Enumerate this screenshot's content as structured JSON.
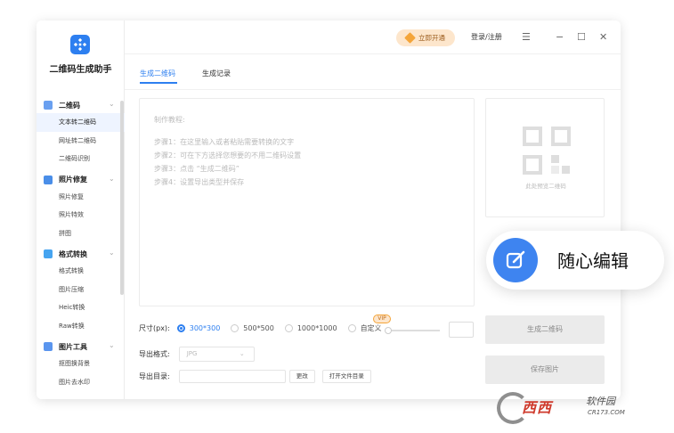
{
  "app": {
    "name": "二维码生成助手",
    "accent_color": "#2d7ff0"
  },
  "titlebar": {
    "vip_button": "立即开通",
    "login_link": "登录/注册",
    "menu_icon": "hamburger-icon",
    "minimize_icon": "minimize-icon",
    "maximize_icon": "maximize-icon",
    "close_icon": "close-icon"
  },
  "sidebar": {
    "groups": [
      {
        "label": "二维码",
        "icon": "qrcode-group-icon",
        "icon_color": "#6aa0f0",
        "items": [
          "文本转二维码",
          "网址转二维码",
          "二维码识别"
        ],
        "active_item": "文本转二维码"
      },
      {
        "label": "照片修复",
        "icon": "photo-repair-group-icon",
        "icon_color": "#4a8ee8",
        "items": [
          "照片修复",
          "照片特效",
          "拼图"
        ]
      },
      {
        "label": "格式转换",
        "icon": "format-convert-group-icon",
        "icon_color": "#46a4f0",
        "items": [
          "格式转换",
          "图片压缩",
          "Heic转换",
          "Raw转换"
        ]
      },
      {
        "label": "图片工具",
        "icon": "image-tools-group-icon",
        "icon_color": "#5a95ee",
        "items": [
          "抠图换背景",
          "图片去水印"
        ]
      }
    ]
  },
  "tabs": [
    {
      "label": "生成二维码",
      "active": true
    },
    {
      "label": "生成记录",
      "active": false
    }
  ],
  "editor": {
    "title": "制作教程:",
    "steps": [
      "步骤1：在这里输入或者粘贴需要转换的文字",
      "步骤2：可在下方选择您想要的不用二维码设置",
      "步骤3：点击 “生成二维码”",
      "步骤4：设置导出类型并保存"
    ]
  },
  "preview": {
    "placeholder": "此处预览二维码",
    "icon": "qrcode-placeholder-icon"
  },
  "float_card": {
    "icon": "edit-icon",
    "label": "随心编辑"
  },
  "options": {
    "size_label": "尺寸(px):",
    "sizes": [
      "300*300",
      "500*500",
      "1000*1000",
      "自定义"
    ],
    "selected_size": "300*300",
    "vip_badge": "VIP",
    "format_label": "导出格式:",
    "format_value": "JPG",
    "dir_label": "导出目录:",
    "change_button": "更改",
    "open_dir_button": "打开文件目录"
  },
  "actions": {
    "generate_button": "生成二维码",
    "save_button": "保存图片"
  },
  "watermark": {
    "main": "西西",
    "sub": "软件园",
    "url": "CR173.COM"
  }
}
